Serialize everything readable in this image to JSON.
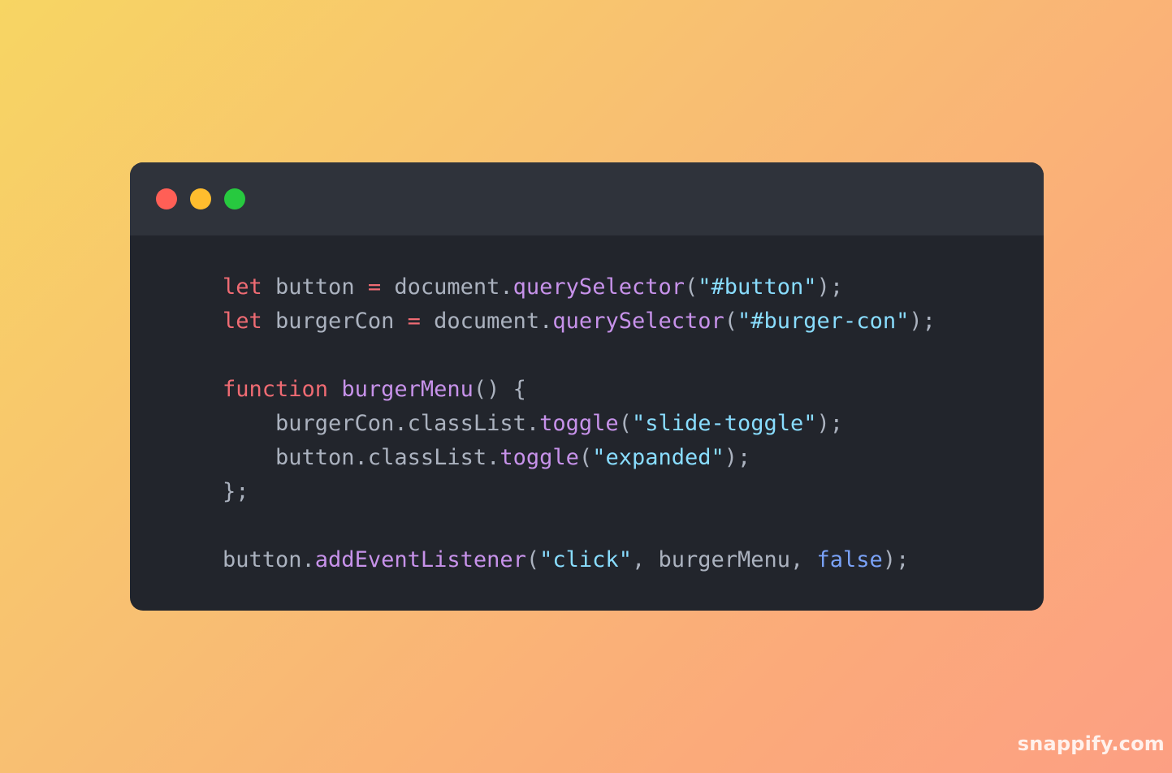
{
  "window": {
    "controls": [
      {
        "name": "close",
        "color": "#ff5f56"
      },
      {
        "name": "minimize",
        "color": "#ffbd2e"
      },
      {
        "name": "maximize",
        "color": "#27c93f"
      }
    ]
  },
  "code": {
    "lines": [
      [
        {
          "t": "keyword",
          "v": "let"
        },
        {
          "t": "plain",
          "v": " button "
        },
        {
          "t": "op",
          "v": "="
        },
        {
          "t": "plain",
          "v": " document."
        },
        {
          "t": "func",
          "v": "querySelector"
        },
        {
          "t": "punct",
          "v": "("
        },
        {
          "t": "string",
          "v": "\"#button\""
        },
        {
          "t": "punct",
          "v": ");"
        }
      ],
      [
        {
          "t": "keyword",
          "v": "let"
        },
        {
          "t": "plain",
          "v": " burgerCon "
        },
        {
          "t": "op",
          "v": "="
        },
        {
          "t": "plain",
          "v": " document."
        },
        {
          "t": "func",
          "v": "querySelector"
        },
        {
          "t": "punct",
          "v": "("
        },
        {
          "t": "string",
          "v": "\"#burger-con\""
        },
        {
          "t": "punct",
          "v": ");"
        }
      ],
      [],
      [
        {
          "t": "keyword",
          "v": "function"
        },
        {
          "t": "plain",
          "v": " "
        },
        {
          "t": "func",
          "v": "burgerMenu"
        },
        {
          "t": "punct",
          "v": "() {"
        }
      ],
      [
        {
          "t": "plain",
          "v": "    burgerCon.classList."
        },
        {
          "t": "func",
          "v": "toggle"
        },
        {
          "t": "punct",
          "v": "("
        },
        {
          "t": "string",
          "v": "\"slide-toggle\""
        },
        {
          "t": "punct",
          "v": ");"
        }
      ],
      [
        {
          "t": "plain",
          "v": "    button.classList."
        },
        {
          "t": "func",
          "v": "toggle"
        },
        {
          "t": "punct",
          "v": "("
        },
        {
          "t": "string",
          "v": "\"expanded\""
        },
        {
          "t": "punct",
          "v": ");"
        }
      ],
      [
        {
          "t": "punct",
          "v": "};"
        }
      ],
      [],
      [
        {
          "t": "plain",
          "v": "button."
        },
        {
          "t": "func",
          "v": "addEventListener"
        },
        {
          "t": "punct",
          "v": "("
        },
        {
          "t": "string",
          "v": "\"click\""
        },
        {
          "t": "punct",
          "v": ", burgerMenu, "
        },
        {
          "t": "bool",
          "v": "false"
        },
        {
          "t": "punct",
          "v": ");"
        }
      ]
    ]
  },
  "watermark": "snappify.com",
  "colors": {
    "background_gradient": [
      "#f7d563",
      "#fc9f83"
    ],
    "window_bg": "#22252c",
    "titlebar_bg": "#2f333b",
    "keyword": "#ef6b73",
    "function": "#c792ea",
    "string": "#89ddff",
    "plain": "#abb2bf"
  }
}
